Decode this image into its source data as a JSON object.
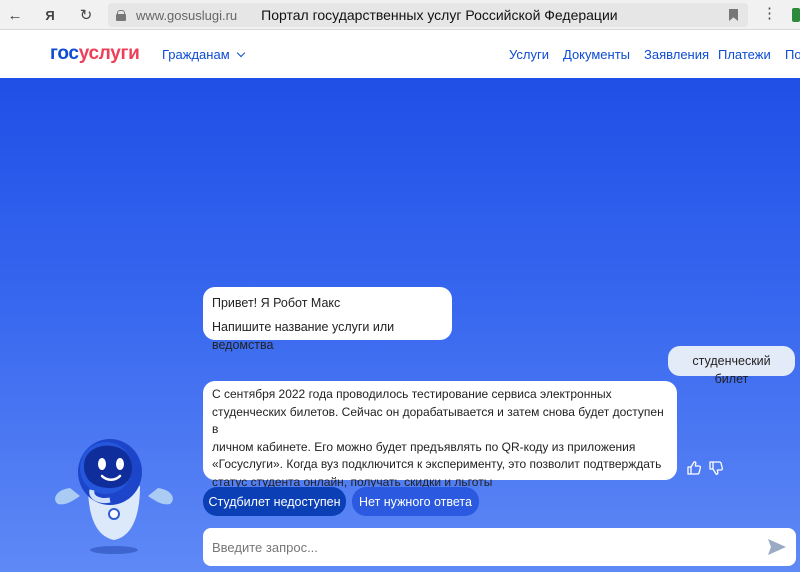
{
  "browser": {
    "back_icon": "←",
    "yandex_icon": "Я",
    "reload_icon": "↻",
    "domain": "www.gosuslugi.ru",
    "page_title": "Портал государственных услуг Российской Федерации",
    "menu_icon": "⋮"
  },
  "header": {
    "logo_part1": "гос",
    "logo_part2": "услуги",
    "audience": "Гражданам",
    "nav": [
      "Услуги",
      "Документы",
      "Заявления",
      "Платежи",
      "По"
    ]
  },
  "chat": {
    "greeting": [
      "Привет! Я Робот Макс",
      "Напишите название услуги или ведомства"
    ],
    "user_message": "студенческий билет",
    "answer_lines": [
      "С сентября 2022 года проводилось тестирование сервиса электронных",
      "студенческих билетов. Сейчас он дорабатывается и затем снова будет доступен в",
      "личном кабинете. Его можно будет предъявлять по QR-коду из приложения",
      "«Госуслуги». Когда вуз подключится к эксперименту, это позволит подтверждать",
      "статус студента онлайн, получать скидки и льготы"
    ],
    "chips": [
      "Студбилет недоступен",
      "Нет нужного ответа"
    ],
    "input_placeholder": "Введите запрос..."
  },
  "colors": {
    "brand_blue": "#0d4cd3",
    "brand_red": "#ee3f58",
    "hero_top": "#1f4fe6",
    "hero_bottom": "#5f89f6",
    "chip_primary": "#0b3fb6",
    "chip_secondary": "#2b5ae0"
  }
}
